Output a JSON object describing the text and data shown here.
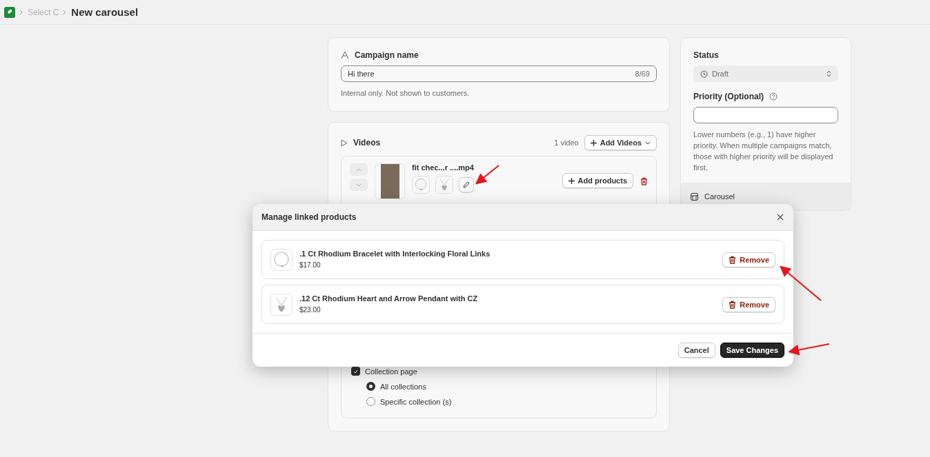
{
  "breadcrumb": {
    "items": [
      "Select C"
    ],
    "title": "New carousel"
  },
  "campaign": {
    "label": "Campaign name",
    "value": "Hi there",
    "counter": "8/69",
    "help": "Internal only. Not shown to customers."
  },
  "videos": {
    "title": "Videos",
    "count": "1 video",
    "add_button": "Add Videos",
    "items": [
      {
        "filename": "fit chec...r ....mp4",
        "add_products": "Add products"
      }
    ]
  },
  "visibility": {
    "options": [
      {
        "kind": "checkbox",
        "label": "Collection page",
        "checked": true
      },
      {
        "kind": "radio",
        "label": "All collections",
        "selected": true
      },
      {
        "kind": "radio",
        "label": "Specific collection (s)",
        "selected": false
      }
    ]
  },
  "status": {
    "label": "Status",
    "value": "Draft"
  },
  "priority": {
    "label": "Priority (Optional)",
    "help": "Lower numbers (e.g., 1) have higher priority. When multiple campaigns match, those with higher priority will be displayed first."
  },
  "layout": {
    "label": "Carousel"
  },
  "modal": {
    "title": "Manage linked products",
    "products": [
      {
        "kind": "bracelet",
        "name": ".1 Ct Rhodium Bracelet with Interlocking Floral Links",
        "price": "$17.00",
        "remove": "Remove"
      },
      {
        "kind": "pendant",
        "name": ".12 Ct Rhodium Heart and Arrow Pendant with CZ",
        "price": "$23.00",
        "remove": "Remove"
      }
    ],
    "cancel": "Cancel",
    "save": "Save Changes"
  }
}
